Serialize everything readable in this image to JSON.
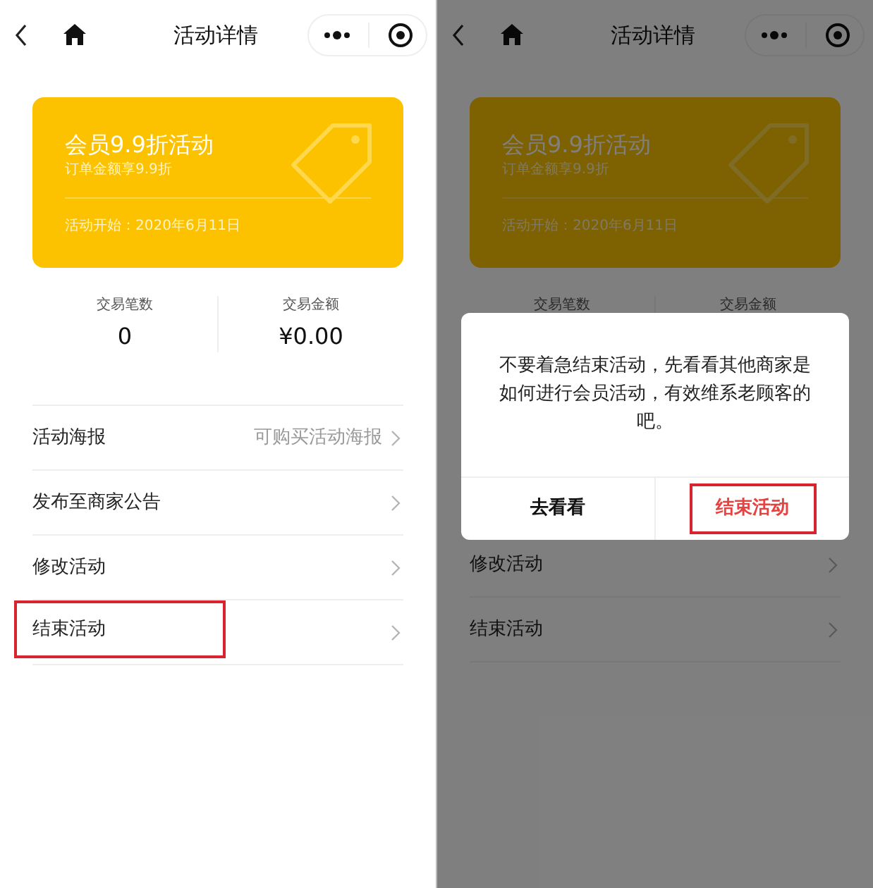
{
  "screens": [
    {
      "nav": {
        "title": "活动详情"
      },
      "card": {
        "title": "会员9.9折活动",
        "subtitle": "订单金额享9.9折",
        "start": "活动开始：2020年6月11日"
      },
      "stats": [
        {
          "label": "交易笔数",
          "value": "0"
        },
        {
          "label": "交易金额",
          "value": "¥0.00"
        }
      ],
      "menu": [
        {
          "label": "活动海报",
          "detail": "可购买活动海报",
          "highlighted": false
        },
        {
          "label": "发布至商家公告",
          "highlighted": false
        },
        {
          "label": "修改活动",
          "highlighted": false
        },
        {
          "label": "结束活动",
          "highlighted": true
        }
      ]
    },
    {
      "nav": {
        "title": "活动详情"
      },
      "card": {
        "title": "会员9.9折活动",
        "subtitle": "订单金额享9.9折",
        "start": "活动开始：2020年6月11日"
      },
      "stats": [
        {
          "label": "交易笔数"
        },
        {
          "label": "交易金额"
        }
      ],
      "dialog": {
        "message": "不要着急结束活动，先看看其他商家是如何进行会员活动，有效维系老顾客的吧。",
        "buttons": [
          {
            "label": "去看看",
            "kind": "cancel",
            "highlighted": false
          },
          {
            "label": "结束活动",
            "kind": "danger",
            "highlighted": true
          }
        ]
      },
      "menu": [
        {
          "label": "修改活动",
          "highlighted": false
        },
        {
          "label": "结束活动",
          "highlighted": false
        }
      ]
    }
  ]
}
